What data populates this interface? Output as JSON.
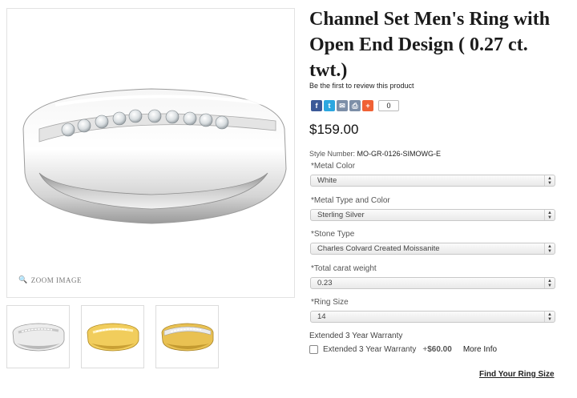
{
  "product": {
    "title": "Channel Set Men's Ring with Open End Design ( 0.27 ct. twt.)",
    "review_text": "Be the first to review this product",
    "price": "$159.00",
    "style_label": "Style Number:",
    "style_number": "MO-GR-0126-SIMOWG-E"
  },
  "gallery": {
    "zoom_label": "ZOOM IMAGE",
    "thumbnails": [
      {
        "metal": "white",
        "color": "#e8e8e8"
      },
      {
        "metal": "yellow",
        "color": "#e8c250"
      },
      {
        "metal": "two-tone",
        "color": "#e0b84a"
      }
    ]
  },
  "share": {
    "count": "0",
    "icons": [
      {
        "name": "facebook-icon",
        "color": "#3b5998",
        "glyph": "f"
      },
      {
        "name": "twitter-icon",
        "color": "#2ca7e0",
        "glyph": "t"
      },
      {
        "name": "email-icon",
        "color": "#7d8fa8",
        "glyph": "✉"
      },
      {
        "name": "print-icon",
        "color": "#7d8fa8",
        "glyph": "⎙"
      },
      {
        "name": "share-plus-icon",
        "color": "#f06135",
        "glyph": "+"
      }
    ]
  },
  "options": {
    "metal_color": {
      "label": "*Metal Color",
      "value": "White"
    },
    "metal_type": {
      "label": "*Metal Type and Color",
      "value": "Sterling Silver"
    },
    "stone_type": {
      "label": "*Stone Type",
      "value": "Charles Colvard Created Moissanite"
    },
    "carat_weight": {
      "label": "*Total carat weight",
      "value": "0.23"
    },
    "ring_size": {
      "label": "*Ring Size",
      "value": "14"
    }
  },
  "warranty": {
    "title": "Extended 3 Year Warranty",
    "option_label": "Extended 3 Year Warranty",
    "price_prefix": "+",
    "price": "$60.00",
    "more_info": "More Info"
  },
  "links": {
    "find_ring_size": "Find Your Ring Size"
  }
}
